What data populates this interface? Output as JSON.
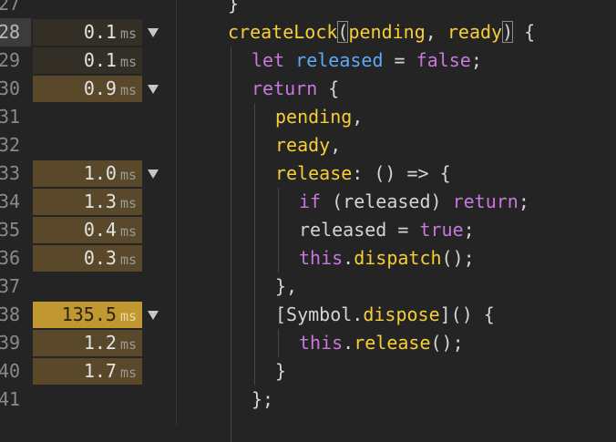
{
  "colors": {
    "background": "#242424",
    "keyword": "#c678dd",
    "function": "#f6ce3a",
    "variable": "#5da9f6",
    "text": "#d4d4d4",
    "hot_timing": "#c09730"
  },
  "fold_icon": "triangle-down-icon",
  "lines": [
    {
      "number": "27",
      "timing": "",
      "unit": "",
      "heat": "",
      "fold": false,
      "current": false,
      "indent": 0,
      "tokens": [
        {
          "text": "}",
          "c": "p"
        }
      ]
    },
    {
      "number": "28",
      "timing": "0.1",
      "unit": "ms",
      "heat": "low",
      "fold": true,
      "current": true,
      "indent": 0,
      "tokens": [
        {
          "text": "createLock",
          "c": "f"
        },
        {
          "text": "(",
          "c": "p bm"
        },
        {
          "text": "pending",
          "c": "f"
        },
        {
          "text": ", ",
          "c": "p"
        },
        {
          "text": "ready",
          "c": "f"
        },
        {
          "text": ")",
          "c": "p bm"
        },
        {
          "text": " {",
          "c": "p"
        }
      ]
    },
    {
      "number": "29",
      "timing": "0.1",
      "unit": "ms",
      "heat": "low",
      "fold": false,
      "current": false,
      "indent": 1,
      "tokens": [
        {
          "text": "let",
          "c": "k"
        },
        {
          "text": " ",
          "c": "w"
        },
        {
          "text": "released",
          "c": "v"
        },
        {
          "text": " = ",
          "c": "p"
        },
        {
          "text": "false",
          "c": "k"
        },
        {
          "text": ";",
          "c": "p"
        }
      ]
    },
    {
      "number": "30",
      "timing": "0.9",
      "unit": "ms",
      "heat": "mid",
      "fold": true,
      "current": false,
      "indent": 1,
      "tokens": [
        {
          "text": "return",
          "c": "k"
        },
        {
          "text": " {",
          "c": "p"
        }
      ]
    },
    {
      "number": "31",
      "timing": "",
      "unit": "",
      "heat": "",
      "fold": false,
      "current": false,
      "indent": 2,
      "tokens": [
        {
          "text": "pending",
          "c": "f"
        },
        {
          "text": ",",
          "c": "p"
        }
      ]
    },
    {
      "number": "32",
      "timing": "",
      "unit": "",
      "heat": "",
      "fold": false,
      "current": false,
      "indent": 2,
      "tokens": [
        {
          "text": "ready",
          "c": "f"
        },
        {
          "text": ",",
          "c": "p"
        }
      ]
    },
    {
      "number": "33",
      "timing": "1.0",
      "unit": "ms",
      "heat": "mid",
      "fold": true,
      "current": false,
      "indent": 2,
      "tokens": [
        {
          "text": "release",
          "c": "f"
        },
        {
          "text": ": () => {",
          "c": "p"
        }
      ]
    },
    {
      "number": "34",
      "timing": "1.3",
      "unit": "ms",
      "heat": "mid",
      "fold": false,
      "current": false,
      "indent": 3,
      "tokens": [
        {
          "text": "if",
          "c": "k"
        },
        {
          "text": " (released) ",
          "c": "p"
        },
        {
          "text": "return",
          "c": "k"
        },
        {
          "text": ";",
          "c": "p"
        }
      ]
    },
    {
      "number": "35",
      "timing": "0.4",
      "unit": "ms",
      "heat": "mid",
      "fold": false,
      "current": false,
      "indent": 3,
      "tokens": [
        {
          "text": "released = ",
          "c": "p"
        },
        {
          "text": "true",
          "c": "k"
        },
        {
          "text": ";",
          "c": "p"
        }
      ]
    },
    {
      "number": "36",
      "timing": "0.3",
      "unit": "ms",
      "heat": "mid",
      "fold": false,
      "current": false,
      "indent": 3,
      "tokens": [
        {
          "text": "this",
          "c": "k"
        },
        {
          "text": ".",
          "c": "p"
        },
        {
          "text": "dispatch",
          "c": "f"
        },
        {
          "text": "();",
          "c": "p"
        }
      ]
    },
    {
      "number": "37",
      "timing": "",
      "unit": "",
      "heat": "",
      "fold": false,
      "current": false,
      "indent": 2,
      "tokens": [
        {
          "text": "},",
          "c": "p"
        }
      ]
    },
    {
      "number": "38",
      "timing": "135.5",
      "unit": "ms",
      "heat": "high",
      "fold": true,
      "current": false,
      "indent": 2,
      "tokens": [
        {
          "text": "[Symbol.",
          "c": "p"
        },
        {
          "text": "dispose",
          "c": "f"
        },
        {
          "text": "]() {",
          "c": "p"
        }
      ]
    },
    {
      "number": "39",
      "timing": "1.2",
      "unit": "ms",
      "heat": "mid",
      "fold": false,
      "current": false,
      "indent": 3,
      "tokens": [
        {
          "text": "this",
          "c": "k"
        },
        {
          "text": ".",
          "c": "p"
        },
        {
          "text": "release",
          "c": "f"
        },
        {
          "text": "();",
          "c": "p"
        }
      ]
    },
    {
      "number": "40",
      "timing": "1.7",
      "unit": "ms",
      "heat": "mid",
      "fold": false,
      "current": false,
      "indent": 2,
      "tokens": [
        {
          "text": "}",
          "c": "p"
        }
      ]
    },
    {
      "number": "41",
      "timing": "",
      "unit": "",
      "heat": "",
      "fold": false,
      "current": false,
      "indent": 1,
      "tokens": [
        {
          "text": "};",
          "c": "p"
        }
      ]
    }
  ]
}
